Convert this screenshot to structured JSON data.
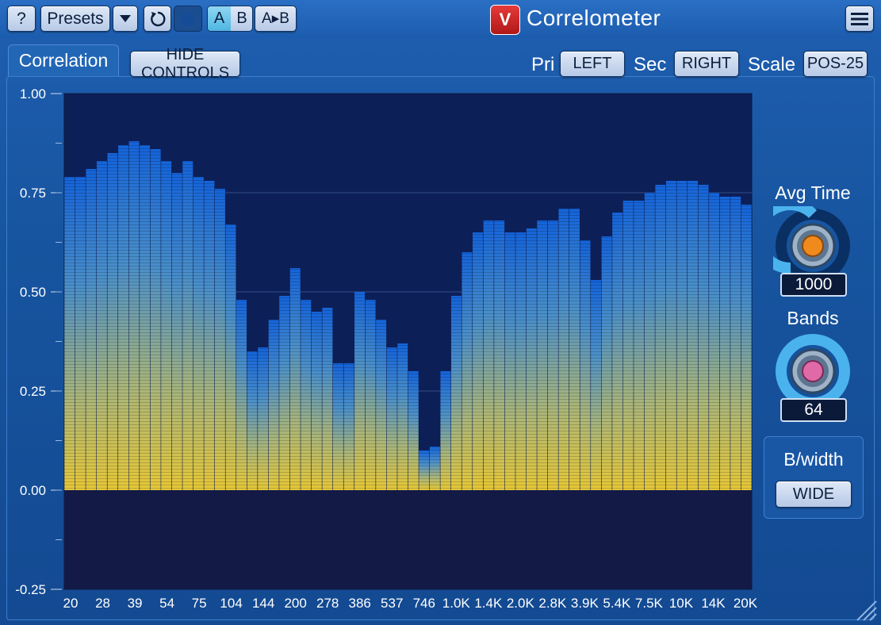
{
  "toolbar": {
    "help_label": "?",
    "presets_label": "Presets",
    "ab_a": "A",
    "ab_b": "B",
    "ab_copy": "A▸B"
  },
  "app": {
    "title": "Correlometer",
    "logo_text": "V"
  },
  "panel": {
    "tab_label": "Correlation",
    "hide_controls_label": "HIDE CONTROLS",
    "pri_label": "Pri",
    "pri_value": "LEFT",
    "sec_label": "Sec",
    "sec_value": "RIGHT",
    "scale_label": "Scale",
    "scale_value": "POS-25"
  },
  "controls": {
    "avg_time_label": "Avg Time",
    "avg_time_value": "1000",
    "bands_label": "Bands",
    "bands_value": "64",
    "bwidth_label": "B/width",
    "bwidth_value": "WIDE"
  },
  "colors": {
    "plot_bg": "#0d1f57",
    "bar_top": "#1e6fd8",
    "bar_bottom": "#e3c43a",
    "accent_knob1": "#f08a1c",
    "accent_knob2": "#e06aa8"
  },
  "chart_data": {
    "type": "bar",
    "ylim": [
      -0.25,
      1.0
    ],
    "yticks": [
      "1.00",
      "0.75",
      "0.50",
      "0.25",
      "0.00",
      "-0.25"
    ],
    "xticks": [
      "20",
      "28",
      "39",
      "54",
      "75",
      "104",
      "144",
      "200",
      "278",
      "386",
      "537",
      "746",
      "1.0K",
      "1.4K",
      "2.0K",
      "2.8K",
      "3.9K",
      "5.4K",
      "7.5K",
      "10K",
      "14K",
      "20K"
    ],
    "values": [
      0.79,
      0.79,
      0.81,
      0.83,
      0.85,
      0.87,
      0.88,
      0.87,
      0.86,
      0.83,
      0.8,
      0.83,
      0.79,
      0.78,
      0.76,
      0.67,
      0.48,
      0.35,
      0.36,
      0.43,
      0.49,
      0.56,
      0.48,
      0.45,
      0.46,
      0.32,
      0.32,
      0.5,
      0.48,
      0.43,
      0.36,
      0.37,
      0.3,
      0.1,
      0.11,
      0.3,
      0.49,
      0.6,
      0.65,
      0.68,
      0.68,
      0.65,
      0.65,
      0.66,
      0.68,
      0.68,
      0.71,
      0.71,
      0.63,
      0.53,
      0.64,
      0.7,
      0.73,
      0.73,
      0.75,
      0.77,
      0.78,
      0.78,
      0.78,
      0.77,
      0.75,
      0.74,
      0.74,
      0.72
    ]
  }
}
